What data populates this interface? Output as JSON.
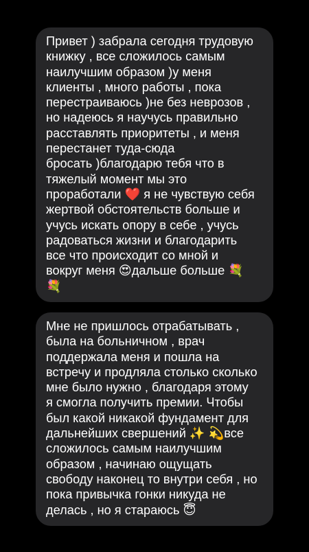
{
  "messages": [
    {
      "lines": [
        "Привет ) забрала сегодня трудовую",
        "книжку , все сложилось самым",
        "наилучшим образом )у меня",
        "клиенты , много работы , пока",
        "перестраиваюсь )не без неврозов ,",
        "но надеюсь я научусь правильно",
        "расставлять приоритеты , и меня",
        "перестанет туда-сюда",
        "бросать )благодарю тебя что в",
        "тяжелый момент мы это",
        "проработали ❤️ я не чувствую себя",
        "жертвой обстоятельств больше  и",
        "учусь искать опору в себе , учусь",
        "радоваться жизни и благодарить",
        "все что происходит со мной и",
        "вокруг меня 😍дальше больше 💐",
        "💐"
      ]
    },
    {
      "lines": [
        "Мне не пришлось отрабатывать ,",
        "была на больничном , врач",
        "поддержала меня и пошла на",
        "встречу и продляла столько сколько",
        "мне было нужно , благодаря этому",
        "я смогла получить премии. Чтобы",
        "был какой никакой фундамент для",
        "дальнейших свершений ✨ 💫все",
        "сложилось самым наилучшим",
        "образом , начинаю ощущать",
        "свободу наконец то внутри себя , но",
        "пока привычка гонки никуда не",
        "делась , но я стараюсь 😇"
      ]
    }
  ],
  "colors": {
    "background": "#000000",
    "bubble": "#262628",
    "text": "#ffffff"
  }
}
